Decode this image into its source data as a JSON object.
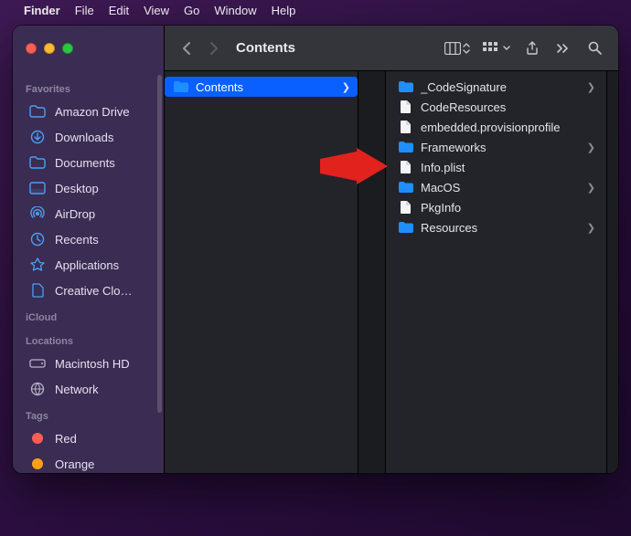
{
  "menubar": {
    "app": "Finder",
    "items": [
      "File",
      "Edit",
      "View",
      "Go",
      "Window",
      "Help"
    ]
  },
  "window": {
    "title": "Contents"
  },
  "sidebar": {
    "sections": [
      {
        "heading": "Favorites",
        "items": [
          {
            "icon": "folder",
            "label": "Amazon Drive"
          },
          {
            "icon": "download",
            "label": "Downloads"
          },
          {
            "icon": "folder",
            "label": "Documents"
          },
          {
            "icon": "desktop",
            "label": "Desktop"
          },
          {
            "icon": "airdrop",
            "label": "AirDrop"
          },
          {
            "icon": "recents",
            "label": "Recents"
          },
          {
            "icon": "apps",
            "label": "Applications"
          },
          {
            "icon": "file",
            "label": "Creative Clo…"
          }
        ]
      },
      {
        "heading": "iCloud",
        "items": []
      },
      {
        "heading": "Locations",
        "items": [
          {
            "icon": "disk",
            "label": "Macintosh HD",
            "grey": true
          },
          {
            "icon": "network",
            "label": "Network",
            "grey": true
          }
        ]
      },
      {
        "heading": "Tags",
        "items": [
          {
            "icon": "tag",
            "label": "Red",
            "color": "#ff5d55"
          },
          {
            "icon": "tag",
            "label": "Orange",
            "color": "#ffa015"
          }
        ]
      }
    ]
  },
  "columns": {
    "col1": [
      {
        "type": "folder",
        "label": "Contents",
        "selected": true,
        "hasChildren": true
      }
    ],
    "col3": [
      {
        "type": "folder",
        "label": "_CodeSignature",
        "hasChildren": true
      },
      {
        "type": "file",
        "label": "CodeResources"
      },
      {
        "type": "file",
        "label": "embedded.provisionprofile"
      },
      {
        "type": "folder",
        "label": "Frameworks",
        "hasChildren": true
      },
      {
        "type": "file",
        "label": "Info.plist",
        "highlighted_by_arrow": true
      },
      {
        "type": "folder",
        "label": "MacOS",
        "hasChildren": true
      },
      {
        "type": "file",
        "label": "PkgInfo"
      },
      {
        "type": "folder",
        "label": "Resources",
        "hasChildren": true
      }
    ]
  }
}
